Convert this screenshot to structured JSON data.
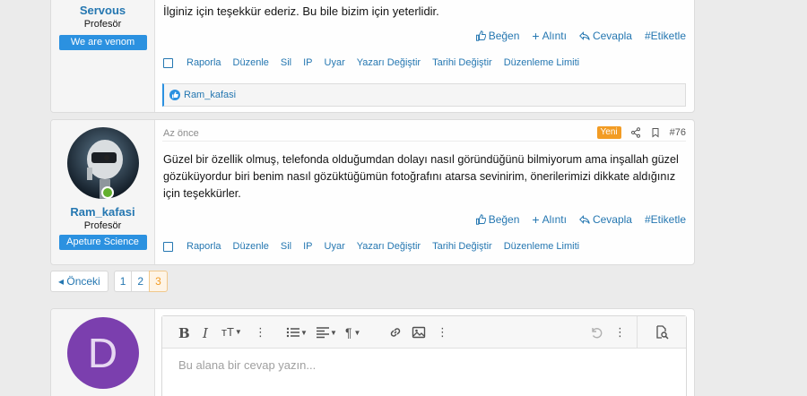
{
  "post1": {
    "username": "Servous",
    "user_title": "Profesör",
    "user_banner": "We are venom",
    "text": "İlginiz için teşekkür ederiz. Bu bile bizim için yeterlidir.",
    "reaction_user": "Ram_kafasi"
  },
  "post2": {
    "time": "Az önce",
    "new_badge": "Yeni",
    "post_number": "#76",
    "username": "Ram_kafasi",
    "user_title": "Profesör",
    "user_banner": "Apeture Science",
    "text": "Güzel bir özellik olmuş, telefonda olduğumdan dolayı nasıl göründüğünü bilmiyorum ama inşallah güzel gözüküyordur biri benim nasıl gözüktüğümün fotoğrafını atarsa sevinirim, önerilerimizi dikkate aldığınız için teşekkürler."
  },
  "actions": {
    "like": "Beğen",
    "quote": "Alıntı",
    "reply": "Cevapla",
    "tag": "#Etiketle"
  },
  "mod_links": [
    "Raporla",
    "Düzenle",
    "Sil",
    "IP",
    "Uyar",
    "Yazarı Değiştir",
    "Tarihi Değiştir",
    "Düzenleme Limiti"
  ],
  "pagination": {
    "prev_label": "◂ Önceki",
    "pages": [
      "1",
      "2",
      "3"
    ],
    "current": "3"
  },
  "reply": {
    "avatar_letter": "D",
    "avatar_color": "#7b3fae",
    "placeholder": "Bu alana bir cevap yazın..."
  },
  "colors": {
    "link": "#2577b1",
    "banner": "#2b91e0",
    "new_badge": "#f29c24"
  }
}
